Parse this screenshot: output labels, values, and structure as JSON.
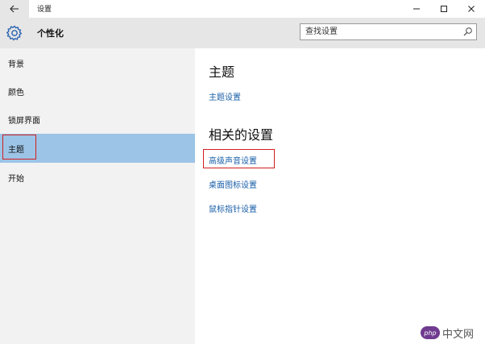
{
  "window": {
    "title": "设置"
  },
  "header": {
    "title": "个性化",
    "search_placeholder": "查找设置"
  },
  "sidebar": {
    "items": [
      {
        "label": "背景"
      },
      {
        "label": "颜色"
      },
      {
        "label": "锁屏界面"
      },
      {
        "label": "主题",
        "selected": true
      },
      {
        "label": "开始"
      }
    ]
  },
  "main": {
    "theme_heading": "主题",
    "theme_settings_link": "主题设置",
    "related_heading": "相关的设置",
    "links": [
      {
        "label": "高级声音设置",
        "highlighted": true
      },
      {
        "label": "桌面图标设置"
      },
      {
        "label": "鼠标指针设置"
      }
    ]
  },
  "watermark": {
    "badge": "php",
    "text": "中文网"
  },
  "colors": {
    "selected_bg": "#9cc4e6",
    "link": "#1a5fa8",
    "highlight_box": "#d11f1f",
    "header_bg": "#e6e6e6",
    "sidebar_bg": "#f2f2f2"
  }
}
